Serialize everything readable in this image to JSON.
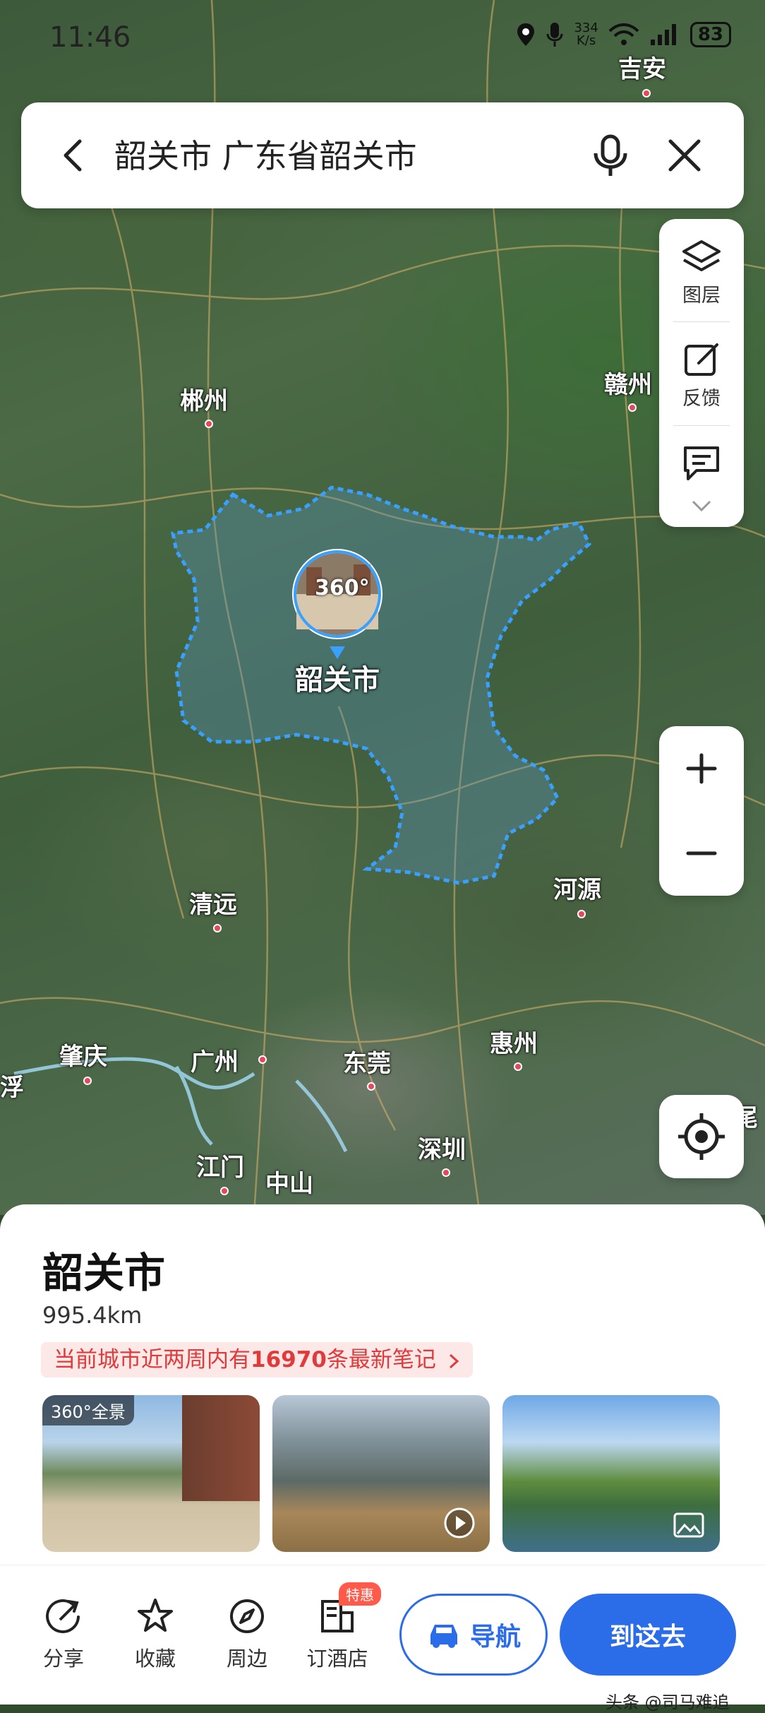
{
  "status_bar": {
    "time": "11:46",
    "net_speed_value": "334",
    "net_speed_unit": "K/s",
    "battery": "83"
  },
  "search": {
    "query": "韶关市 广东省韶关市"
  },
  "map_tools": {
    "layers_label": "图层",
    "feedback_label": "反馈"
  },
  "map": {
    "cities": [
      "吉安",
      "郴州",
      "赣州",
      "清远",
      "河源",
      "肇庆",
      "广州",
      "东莞",
      "惠州",
      "江门",
      "中山",
      "深圳",
      "浮",
      "尾"
    ],
    "marker_label": "韶关市",
    "pano_text": "360°",
    "boundary_color": "#3aa0ff"
  },
  "place": {
    "name": "韶关市",
    "distance": "995.4km",
    "notes_prefix": "当前城市近两周内有",
    "notes_count": "16970",
    "notes_suffix": "条最新笔记",
    "pano_badge": "全景"
  },
  "bottom_bar": {
    "share": "分享",
    "favorite": "收藏",
    "nearby": "周边",
    "hotel": "订酒店",
    "hotel_badge": "特惠",
    "navigate": "导航",
    "go_here": "到这去"
  },
  "watermark": "头条 @司马难追"
}
